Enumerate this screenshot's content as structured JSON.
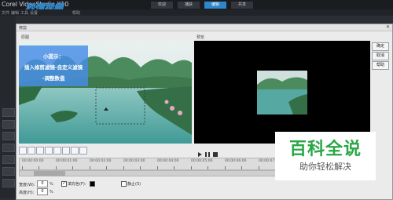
{
  "app": {
    "title": "Corel VideoStudio X10",
    "tabs": [
      {
        "label": "欢迎",
        "active": false
      },
      {
        "label": "捕获",
        "active": false
      },
      {
        "label": "编辑",
        "active": true
      },
      {
        "label": "共享",
        "active": false
      }
    ],
    "menu": [
      "文件",
      "编辑",
      "工具",
      "设置",
      "帮助"
    ]
  },
  "watermark_logo": "秒懂视频",
  "dialog": {
    "title": "修剪",
    "close_glyph": "✕",
    "original_label": "原图",
    "preview_label": "预览",
    "side_buttons": [
      "确定",
      "取消",
      "帮助"
    ]
  },
  "tip": {
    "lines": [
      "小提示：",
      "插入修剪滤镜-自定义滤镜",
      "-调整数值"
    ]
  },
  "timeline": {
    "ruler_labels": [
      "00:00:00:00",
      "00:00:01:00",
      "00:00:02:00",
      "00:00:03:00",
      "00:00:04:00",
      "00:00:05:00",
      "00:00:06:00",
      "00:00:07:00"
    ]
  },
  "params": {
    "width_label": "宽度(W):",
    "width_value": "0",
    "width_unit": "%",
    "height_label": "高度(H):",
    "height_value": "0",
    "height_unit": "%",
    "fill_color_label": "填充色(F):",
    "fill_color_checked": true,
    "fill_color": "#000000",
    "static_label": "静止(S)",
    "static_checked": false
  },
  "baike": {
    "title": "百科全说",
    "subtitle": "助你轻松解决",
    "title_color": "#28a745"
  },
  "colors": {
    "accent": "#2f86c9",
    "tip_bg": "#468ce6"
  }
}
